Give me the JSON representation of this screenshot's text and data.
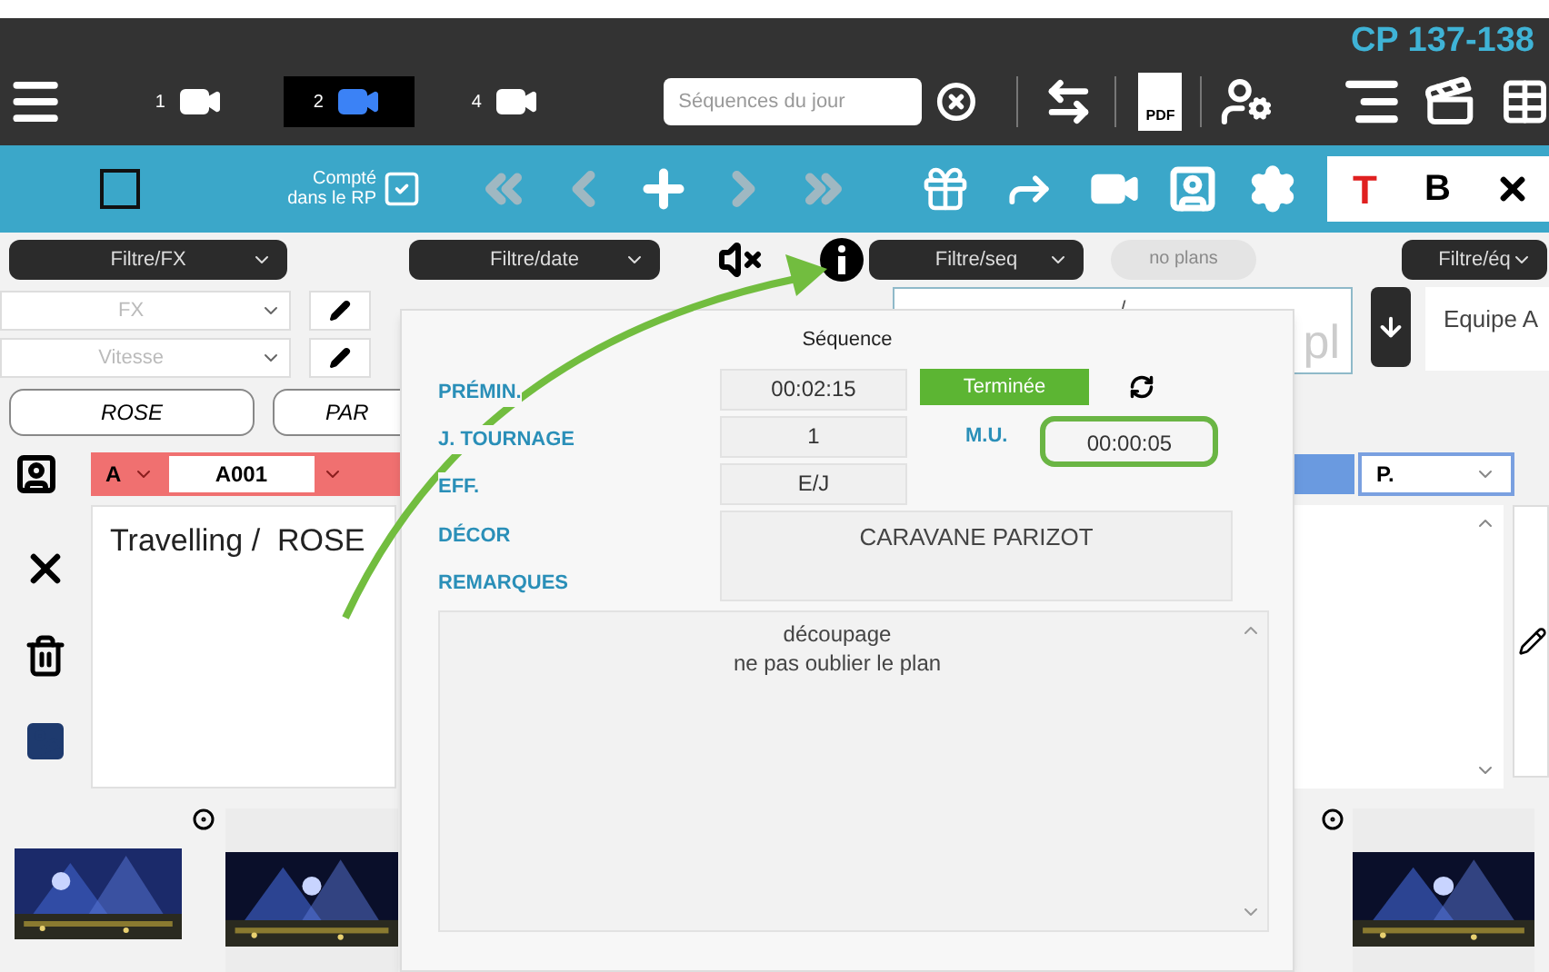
{
  "header": {
    "title": "CP 137-138",
    "pdf_label": "PDF"
  },
  "camera_tabs": [
    {
      "label": "1",
      "selected": false
    },
    {
      "label": "2",
      "selected": true
    },
    {
      "label": "4",
      "selected": false
    }
  ],
  "search": {
    "placeholder": "Séquences du jour"
  },
  "toolbar": {
    "select_checked": false,
    "counted_label": "Compté dans le RP",
    "counted_checked": true,
    "text_color_label": "T",
    "bold_label": "B",
    "nav": [
      {
        "kind": "first",
        "disabled": true
      },
      {
        "kind": "prev",
        "disabled": true
      },
      {
        "kind": "add",
        "disabled": false
      },
      {
        "kind": "next",
        "disabled": true
      },
      {
        "kind": "last",
        "disabled": true
      }
    ]
  },
  "filters": {
    "fx": "Filtre/FX",
    "date": "Filtre/date",
    "seq": "Filtre/seq",
    "team": "Filtre/éq",
    "plans_button": {
      "label": "no plans",
      "disabled": true
    }
  },
  "fx_select": {
    "placeholder": "FX"
  },
  "speed_select": {
    "placeholder": "Vitesse"
  },
  "sequence_field": {
    "value": "/",
    "suffix": "pl"
  },
  "team": "Equipe A",
  "tags": [
    {
      "label": "ROSE"
    },
    {
      "label": "PAR"
    }
  ],
  "shot": {
    "camera": "A",
    "code": "A001",
    "description": "Travelling /  ROSE",
    "position": "P."
  },
  "popover": {
    "title": "Séquence",
    "fields": [
      {
        "label": "PRÉMIN.",
        "value": "00:02:15"
      },
      {
        "label": "J. TOURNAGE",
        "value": "1"
      },
      {
        "label": "EFF.",
        "value": "E/J"
      }
    ],
    "status": "Terminée",
    "mu": {
      "label": "M.U.",
      "value": "00:00:05",
      "highlighted": true
    },
    "decor": {
      "label": "DÉCOR",
      "value": "CARAVANE PARIZOT"
    },
    "remarks": {
      "label": "REMARQUES",
      "lines": [
        "découpage",
        "ne pas oublier le plan"
      ]
    }
  }
}
